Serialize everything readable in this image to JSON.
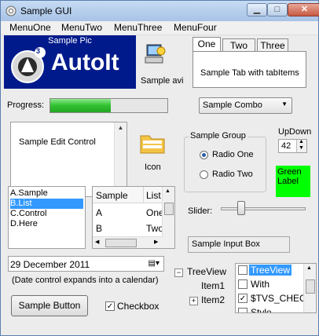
{
  "window": {
    "title": "Sample GUI"
  },
  "menu": [
    "MenuOne",
    "MenuTwo",
    "MenuThree",
    "MenuFour"
  ],
  "pic": {
    "caption": "Sample Pic",
    "logo_text": "AutoIt",
    "logo_badge": "3"
  },
  "avi": {
    "label": "Sample avi"
  },
  "tabs": {
    "labels": [
      "One",
      "Two",
      "Three"
    ],
    "content": "Sample Tab with tabItems"
  },
  "progress": {
    "label": "Progress:",
    "value": 0.52
  },
  "combo": {
    "value": "Sample Combo"
  },
  "edit": {
    "text": "Sample Edit Control"
  },
  "icon": {
    "label": "Icon"
  },
  "group": {
    "title": "Sample Group",
    "radios": [
      "Radio One",
      "Radio Two"
    ]
  },
  "updown": {
    "label": "UpDown",
    "value": "42"
  },
  "green_label": {
    "text": "Green\nLabel",
    "color": "#00ff00"
  },
  "list": {
    "items": [
      "A.Sample",
      "B.List",
      "C.Control",
      "D.Here"
    ],
    "selected_index": 1
  },
  "listview": {
    "headers": [
      "Sample",
      "List"
    ],
    "rows": [
      [
        "A",
        "One"
      ],
      [
        "B",
        "Two"
      ]
    ]
  },
  "slider": {
    "label": "Slider:",
    "value": 0.21
  },
  "input": {
    "value": "Sample Input Box"
  },
  "date": {
    "value": "29 December 2011",
    "note": "(Date control expands into a calendar)"
  },
  "tree": {
    "root": "TreeView",
    "children": [
      "Item1",
      "Item2"
    ]
  },
  "treecheck": {
    "items": [
      {
        "label": "TreeView",
        "checked": false,
        "selected": true
      },
      {
        "label": "With",
        "checked": false,
        "selected": false
      },
      {
        "label": "$TVS_CHECK",
        "checked": true,
        "selected": false
      },
      {
        "label": "Style",
        "checked": false,
        "selected": false
      }
    ]
  },
  "button": {
    "label": "Sample Button"
  },
  "checkbox": {
    "label": "Checkbox",
    "checked": true
  }
}
